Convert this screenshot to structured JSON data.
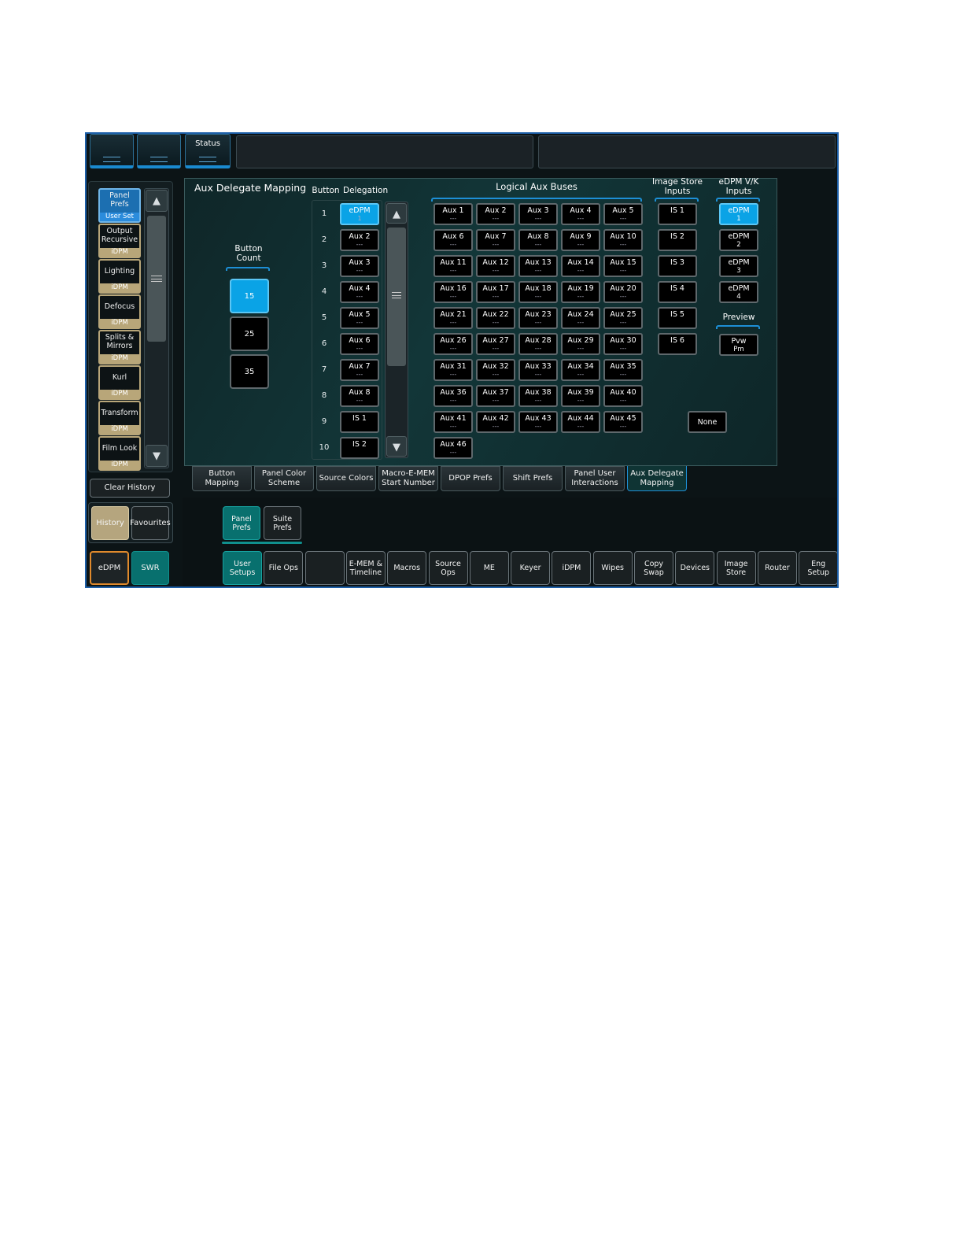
{
  "top": {
    "btn1": "",
    "btn2": "",
    "status": "Status"
  },
  "nav": {
    "items": [
      {
        "label": "Panel Prefs",
        "sub": "User Set"
      },
      {
        "label": "Output Recursive",
        "sub": "iDPM"
      },
      {
        "label": "Lighting",
        "sub": "iDPM"
      },
      {
        "label": "Defocus",
        "sub": "iDPM"
      },
      {
        "label": "Splits & Mirrors",
        "sub": "iDPM"
      },
      {
        "label": "Kurl",
        "sub": "iDPM"
      },
      {
        "label": "Transform",
        "sub": "iDPM"
      },
      {
        "label": "Film Look",
        "sub": "iDPM"
      }
    ],
    "clear_history": "Clear History",
    "history": "History",
    "favourites": "Favourites",
    "edpm": "eDPM",
    "swr": "SWR"
  },
  "panel": {
    "title": "Aux Delegate Mapping",
    "button_count_label": "Button Count",
    "button_counts": [
      "15",
      "25",
      "35"
    ],
    "col_button": "Button",
    "col_delegation": "Delegation",
    "rows": [
      {
        "num": "1",
        "label": "eDPM",
        "detail": "1"
      },
      {
        "num": "2",
        "label": "Aux 2",
        "detail": "---"
      },
      {
        "num": "3",
        "label": "Aux 3",
        "detail": "---"
      },
      {
        "num": "4",
        "label": "Aux 4",
        "detail": "---"
      },
      {
        "num": "5",
        "label": "Aux 5",
        "detail": "---"
      },
      {
        "num": "6",
        "label": "Aux 6",
        "detail": "---"
      },
      {
        "num": "7",
        "label": "Aux 7",
        "detail": "---"
      },
      {
        "num": "8",
        "label": "Aux 8",
        "detail": "---"
      },
      {
        "num": "9",
        "label": "IS 1",
        "detail": ""
      },
      {
        "num": "10",
        "label": "IS 2",
        "detail": ""
      }
    ],
    "logical_aux_label": "Logical Aux Buses",
    "aux_buses": [
      {
        "label": "Aux 1",
        "detail": "---"
      },
      {
        "label": "Aux 2",
        "detail": "---"
      },
      {
        "label": "Aux 3",
        "detail": "---"
      },
      {
        "label": "Aux 4",
        "detail": "---"
      },
      {
        "label": "Aux 5",
        "detail": "---"
      },
      {
        "label": "Aux 6",
        "detail": "---"
      },
      {
        "label": "Aux 7",
        "detail": "---"
      },
      {
        "label": "Aux 8",
        "detail": "---"
      },
      {
        "label": "Aux 9",
        "detail": "---"
      },
      {
        "label": "Aux 10",
        "detail": "---"
      },
      {
        "label": "Aux 11",
        "detail": "---"
      },
      {
        "label": "Aux 12",
        "detail": "---"
      },
      {
        "label": "Aux 13",
        "detail": "---"
      },
      {
        "label": "Aux 14",
        "detail": "---"
      },
      {
        "label": "Aux 15",
        "detail": "---"
      },
      {
        "label": "Aux 16",
        "detail": "---"
      },
      {
        "label": "Aux 17",
        "detail": "---"
      },
      {
        "label": "Aux 18",
        "detail": "---"
      },
      {
        "label": "Aux 19",
        "detail": "---"
      },
      {
        "label": "Aux 20",
        "detail": "---"
      },
      {
        "label": "Aux 21",
        "detail": "---"
      },
      {
        "label": "Aux 22",
        "detail": "---"
      },
      {
        "label": "Aux 23",
        "detail": "---"
      },
      {
        "label": "Aux 24",
        "detail": "---"
      },
      {
        "label": "Aux 25",
        "detail": "---"
      },
      {
        "label": "Aux 26",
        "detail": "---"
      },
      {
        "label": "Aux 27",
        "detail": "---"
      },
      {
        "label": "Aux 28",
        "detail": "---"
      },
      {
        "label": "Aux 29",
        "detail": "---"
      },
      {
        "label": "Aux 30",
        "detail": "---"
      },
      {
        "label": "Aux 31",
        "detail": "---"
      },
      {
        "label": "Aux 32",
        "detail": "---"
      },
      {
        "label": "Aux 33",
        "detail": "---"
      },
      {
        "label": "Aux 34",
        "detail": "---"
      },
      {
        "label": "Aux 35",
        "detail": "---"
      },
      {
        "label": "Aux 36",
        "detail": "---"
      },
      {
        "label": "Aux 37",
        "detail": "---"
      },
      {
        "label": "Aux 38",
        "detail": "---"
      },
      {
        "label": "Aux 39",
        "detail": "---"
      },
      {
        "label": "Aux 40",
        "detail": "---"
      },
      {
        "label": "Aux 41",
        "detail": "---"
      },
      {
        "label": "Aux 42",
        "detail": "---"
      },
      {
        "label": "Aux 43",
        "detail": "---"
      },
      {
        "label": "Aux 44",
        "detail": "---"
      },
      {
        "label": "Aux 45",
        "detail": "---"
      },
      {
        "label": "Aux 46",
        "detail": "---"
      }
    ],
    "image_store_label": "Image Store Inputs",
    "image_store": [
      "IS 1",
      "IS 2",
      "IS 3",
      "IS 4",
      "IS 5",
      "IS 6"
    ],
    "edpm_label": "eDPM V/K Inputs",
    "edpm_inputs": [
      {
        "label": "eDPM",
        "detail": "1"
      },
      {
        "label": "eDPM",
        "detail": "2"
      },
      {
        "label": "eDPM",
        "detail": "3"
      },
      {
        "label": "eDPM",
        "detail": "4"
      }
    ],
    "preview_label": "Preview",
    "preview": {
      "label": "Pvw",
      "detail": "Pm"
    },
    "none": "None"
  },
  "tabs": [
    "Button Mapping",
    "Panel Color Scheme",
    "Source Colors",
    "Macro-E-MEM Start Number",
    "DPOP Prefs",
    "Shift Prefs",
    "Panel User Interactions",
    "Aux Delegate Mapping"
  ],
  "subtabs": [
    "Panel Prefs",
    "Suite Prefs"
  ],
  "bottom": [
    "User Setups",
    "File Ops",
    "",
    "E-MEM & Timeline",
    "Macros",
    "Source Ops",
    "ME",
    "Keyer",
    "iDPM",
    "Wipes",
    "Copy Swap",
    "Devices",
    "Image Store",
    "Router",
    "Eng Setup"
  ],
  "colors": {
    "accent": "#0aa3e6",
    "teal": "#08706e",
    "tan": "#b5a57e",
    "frame": "#1d5fa8"
  }
}
